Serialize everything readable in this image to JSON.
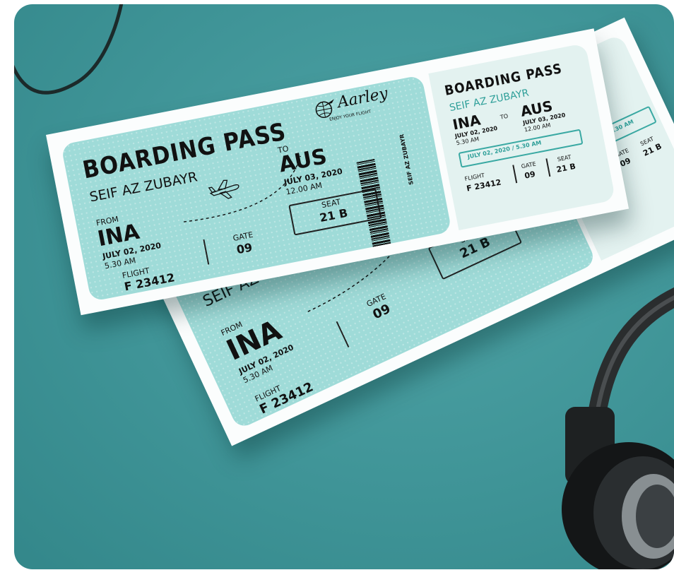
{
  "ticket": {
    "brand": "Aarley",
    "tagline": "ENJOY YOUR FLIGHT",
    "title": "BOARDING PASS",
    "passenger": "SEIF AZ ZUBAYR",
    "from_label": "FROM",
    "origin": "INA",
    "origin_date": "JULY 02, 2020",
    "origin_time": "5.30 AM",
    "to_label": "TO",
    "destination": "AUS",
    "destination_date": "JULY 03, 2020",
    "destination_time": "12.00 AM",
    "flight_label": "FLIGHT",
    "flight": "F 23412",
    "gate_label": "GATE",
    "gate": "09",
    "seat_label": "SEAT",
    "seat": "21 B",
    "barcode_name": "SEIF AZ ZUBAYR",
    "stub_date": "JULY 02, 2020 / 5.30 AM"
  },
  "colors": {
    "background": "#3f9497",
    "ticket_main": "#9fdbd8",
    "stub": "#e3f2f0",
    "accent": "#2e9f99"
  },
  "icons": [
    "globe-plane-logo-icon",
    "airplane-icon",
    "barcode-icon",
    "headphones-icon"
  ]
}
